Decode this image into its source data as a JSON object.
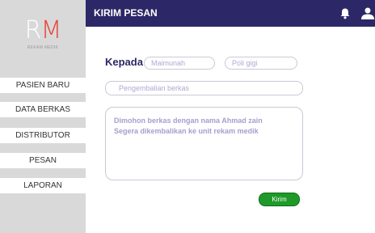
{
  "logo": {
    "initial_r": "R",
    "initial_m": "M",
    "subtitle": "REKAM MEDIK"
  },
  "sidebar": {
    "items": [
      {
        "label": "PASIEN BARU"
      },
      {
        "label": "DATA BERKAS"
      },
      {
        "label": "DISTRIBUTOR"
      },
      {
        "label": "PESAN"
      },
      {
        "label": "LAPORAN"
      }
    ]
  },
  "header": {
    "title": "KIRIM PESAN",
    "icons": [
      "bell-icon",
      "user-icon"
    ]
  },
  "form": {
    "recipient_label": "Kepada",
    "recipient_name": "Maimunah",
    "recipient_unit": "Poli gigi",
    "subject": "Pengembalian berkas",
    "message_line1": "Dimohon berkas dengan nama Ahmad zain",
    "message_line2": "Segera dikembalikan ke unit rekam medik",
    "send_label": "Kirim"
  },
  "colors": {
    "header_bg": "#2c2766",
    "sidebar_bg": "#d9d9d9",
    "logo_accent": "#e8453c",
    "send_button": "#1f9a2a",
    "placeholder_text": "#a59ed0"
  }
}
